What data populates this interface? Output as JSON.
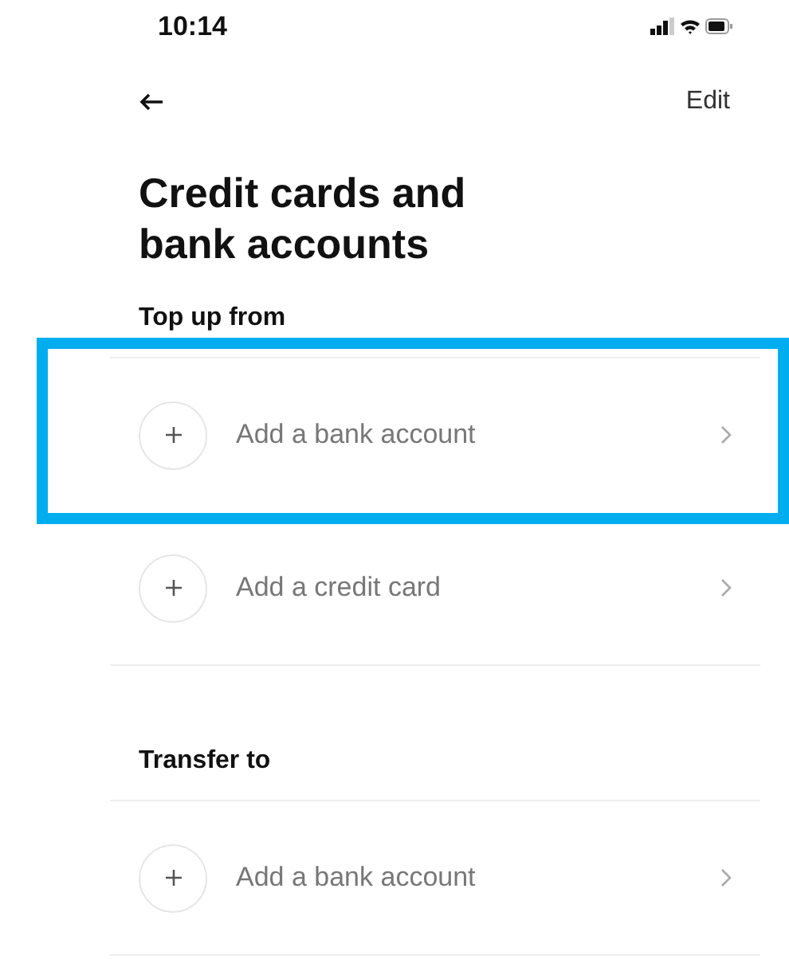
{
  "status_bar": {
    "time": "10:14"
  },
  "nav": {
    "action": "Edit"
  },
  "title": "Credit cards and bank accounts",
  "sections": [
    {
      "heading": "Top up from",
      "items": [
        {
          "label": "Add a bank account",
          "highlighted": true
        },
        {
          "label": "Add a credit card",
          "highlighted": false
        }
      ]
    },
    {
      "heading": "Transfer to",
      "items": [
        {
          "label": "Add a bank account",
          "highlighted": false
        }
      ]
    }
  ]
}
